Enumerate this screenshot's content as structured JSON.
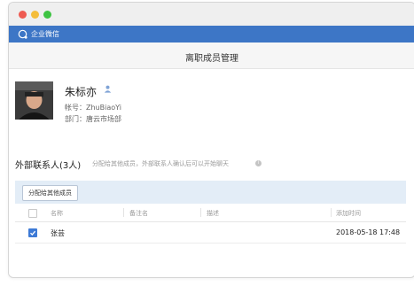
{
  "app": {
    "name": "企业微信"
  },
  "page": {
    "title": "离职成员管理"
  },
  "member": {
    "name": "朱标亦",
    "account_label": "帐号：",
    "account": "ZhuBiaoYi",
    "dept_label": "部门：",
    "dept": "唐云市场部"
  },
  "external": {
    "title": "外部联系人(3人)",
    "hint": "分配给其他成员，外部联系人确认后可以开始聊天",
    "assign_button": "分配给其他成员"
  },
  "table": {
    "columns": [
      "名称",
      "备注名",
      "描述",
      "添加时间"
    ],
    "rows": [
      {
        "checked": true,
        "name": "张芸",
        "remark": "",
        "desc": "",
        "time": "2018-05-18 17:48"
      }
    ]
  },
  "colors": {
    "appbar": "#3d76c6",
    "toolbar": "#e3edf7",
    "checkbox": "#3d7ad6"
  }
}
